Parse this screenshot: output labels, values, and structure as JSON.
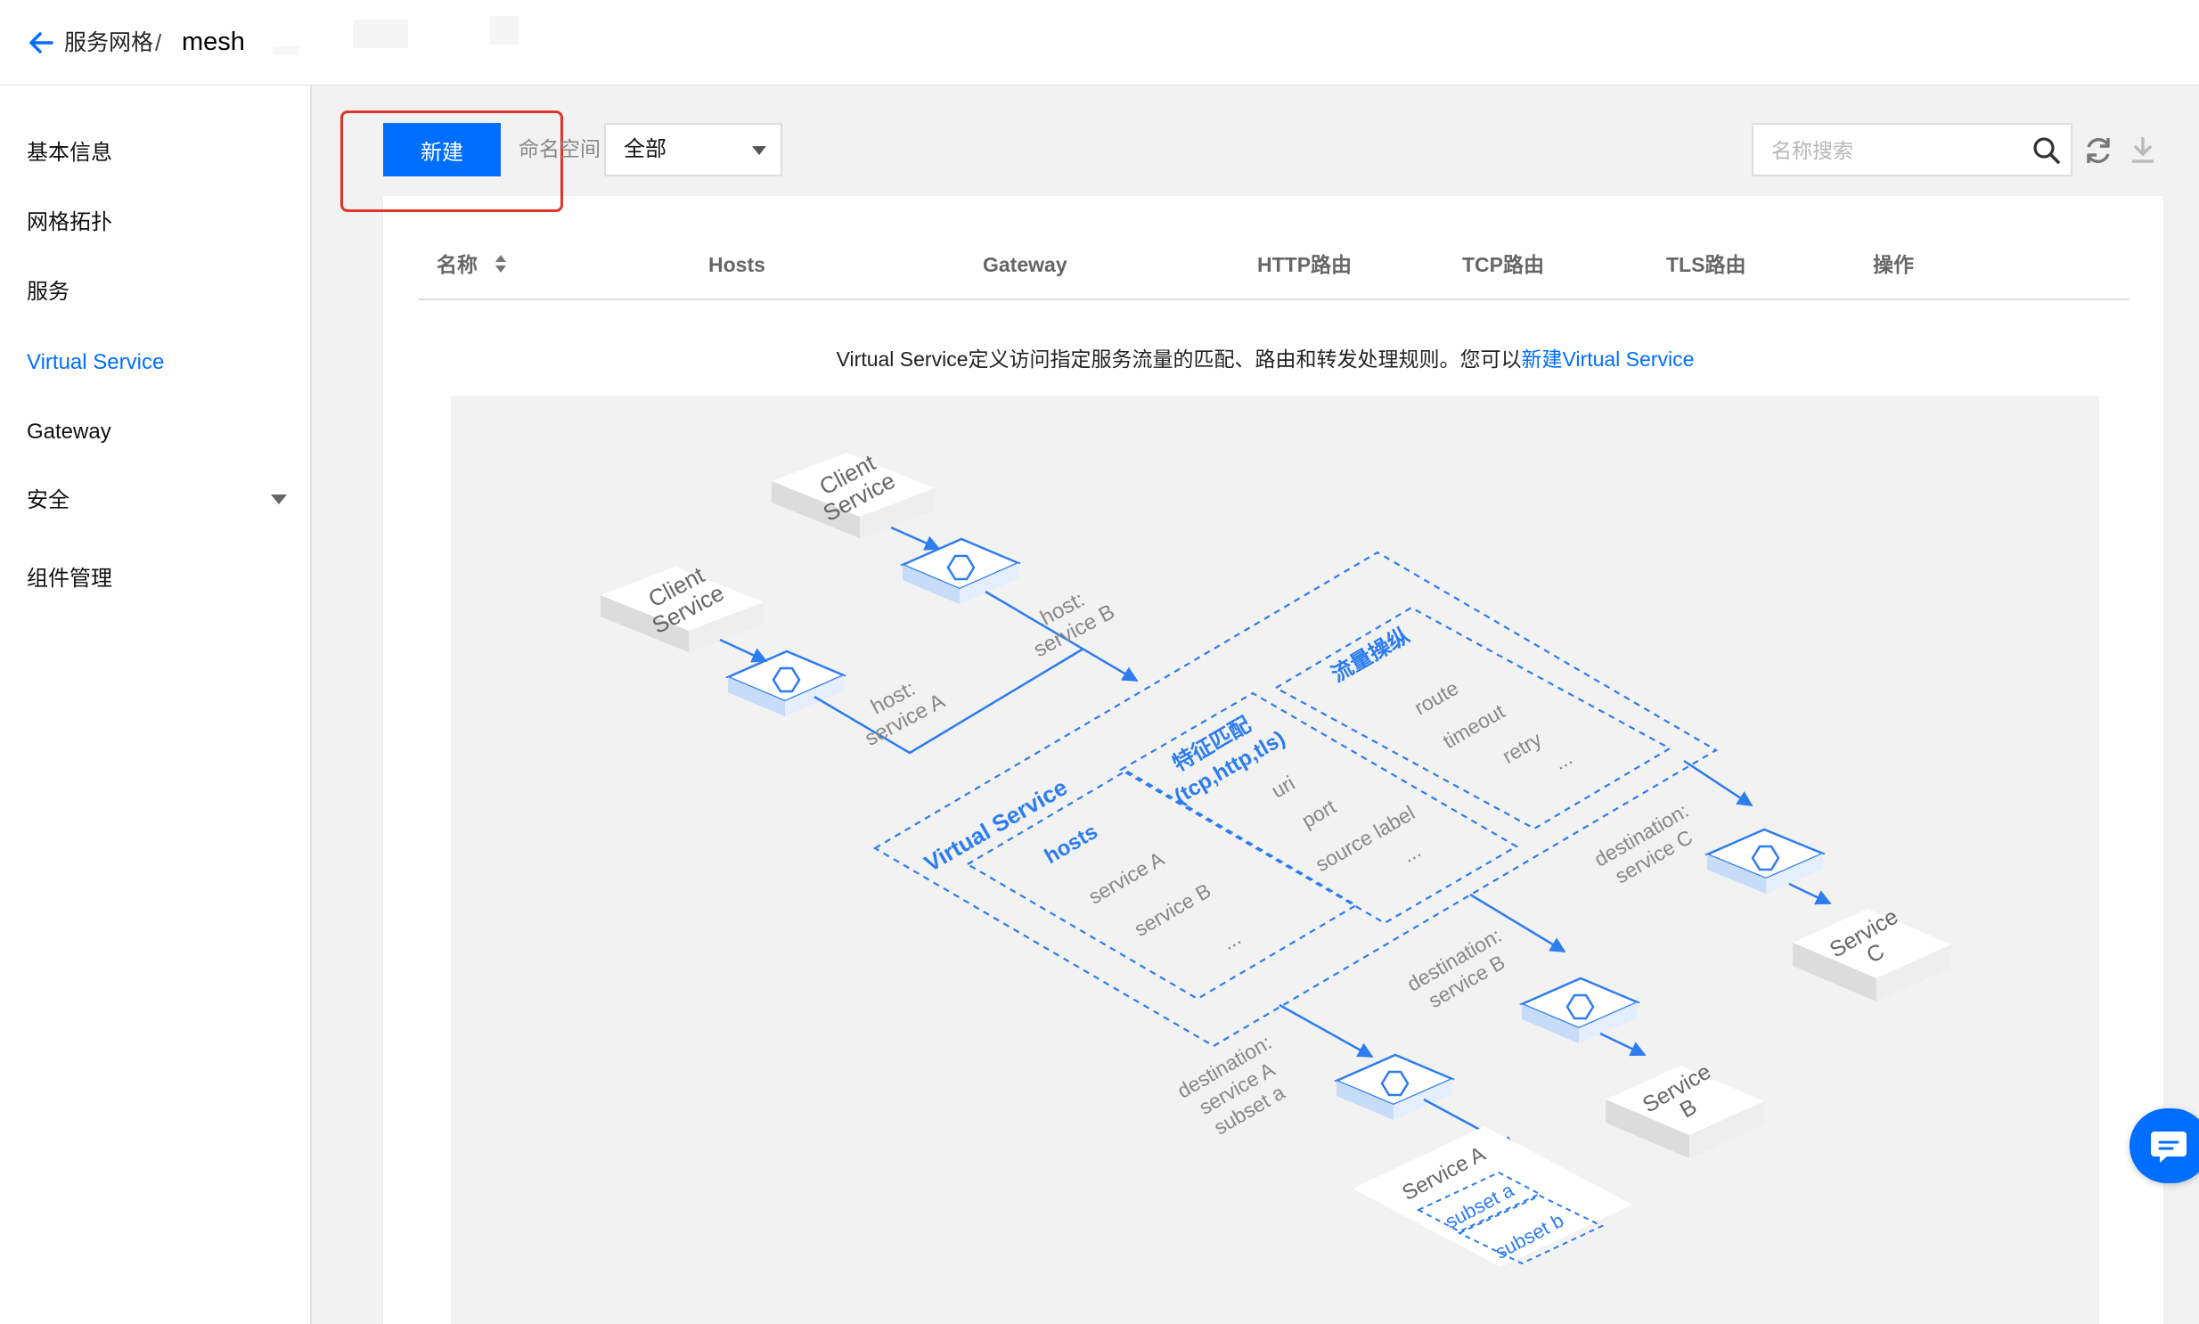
{
  "header": {
    "breadcrumb_parent": "服务网格",
    "breadcrumb_sep": "/",
    "breadcrumb_current": "mesh"
  },
  "sidebar": {
    "items": [
      {
        "label": "基本信息"
      },
      {
        "label": "网格拓扑"
      },
      {
        "label": "服务"
      },
      {
        "label": "Virtual Service",
        "active": true
      },
      {
        "label": "Gateway"
      },
      {
        "label": "安全",
        "has_submenu": true
      },
      {
        "label": "组件管理"
      }
    ]
  },
  "toolbar": {
    "new_button": "新建",
    "namespace_label": "命名空间",
    "namespace_value": "全部",
    "search_placeholder": "名称搜索"
  },
  "table": {
    "columns": [
      "名称",
      "Hosts",
      "Gateway",
      "HTTP路由",
      "TCP路由",
      "TLS路由",
      "操作"
    ]
  },
  "empty_state": {
    "text": "Virtual Service定义访问指定服务流量的匹配、路由和转发处理规则。您可以",
    "link": "新建Virtual Service"
  },
  "diagram": {
    "client_label_1": "Client",
    "client_label_2": "Service",
    "host_a_1": "host:",
    "host_a_2": "service A",
    "host_b_1": "host:",
    "host_b_2": "service B",
    "vs_title": "Virtual Service",
    "hosts_title": "hosts",
    "hosts_items": [
      "service A",
      "service B",
      "..."
    ],
    "match_title_1": "特征匹配",
    "match_title_2": "(tcp,http,tls)",
    "match_items": [
      "uri",
      "port",
      "source label",
      "..."
    ],
    "traffic_title": "流量操纵",
    "traffic_items": [
      "route",
      "timeout",
      "retry",
      "..."
    ],
    "dest_a": [
      "destination:",
      "service A",
      "subset a"
    ],
    "dest_b": [
      "destination:",
      "service B"
    ],
    "dest_c": [
      "destination:",
      "service C"
    ],
    "service_b": [
      "Service",
      "B"
    ],
    "service_c": [
      "Service",
      "C"
    ],
    "service_a_box": "Service A",
    "subset_a": "subset a",
    "subset_b": "subset b"
  },
  "colors": {
    "accent": "#006eff",
    "highlight": "#e0352a",
    "diagram_blue": "#2d7cf0"
  }
}
